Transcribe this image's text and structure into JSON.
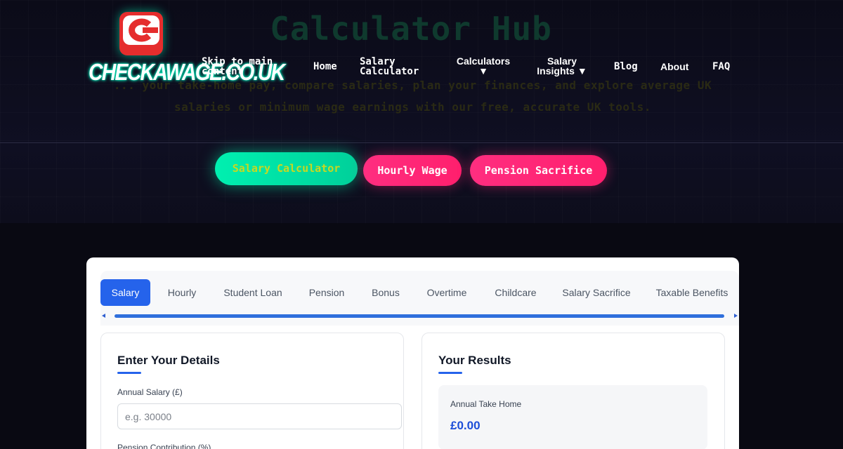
{
  "hero": {
    "title": "Calculator Hub",
    "subtitle": "... your take-home pay, compare salaries, plan your finances, and explore average UK salaries or minimum wage earnings with our free, accurate UK tools."
  },
  "logo": {
    "badge_letter": "C",
    "text": "CHECKAWAGE.CO.UK"
  },
  "nav": {
    "skip_link": "Skip to main content",
    "home": "Home",
    "salary_calculator": "Salary Calculator",
    "calculators": "Calculators ▼",
    "salary_insights": "Salary Insights ▼",
    "blog": "Blog",
    "about": "About",
    "faq": "FAQ"
  },
  "quick_links": [
    "Salary Calculator",
    "Hourly Wage",
    "Pension Sacrifice"
  ],
  "tabs": [
    "Salary",
    "Hourly",
    "Student Loan",
    "Pension",
    "Bonus",
    "Overtime",
    "Childcare",
    "Salary Sacrifice",
    "Taxable Benefits"
  ],
  "active_tab": "Salary",
  "details": {
    "title": "Enter Your Details",
    "annual_salary_label": "Annual Salary (£)",
    "annual_salary_placeholder": "e.g. 30000",
    "pension_label": "Pension Contribution (%)"
  },
  "results": {
    "title": "Your Results",
    "annual_take_home_label": "Annual Take Home",
    "annual_take_home_value": "£0.00"
  },
  "colors": {
    "accent_blue": "#2563eb",
    "neon_green": "#00f0b0",
    "neon_pink": "#ff2e80",
    "logo_red": "#e52d2d",
    "page_bg": "#090912"
  }
}
